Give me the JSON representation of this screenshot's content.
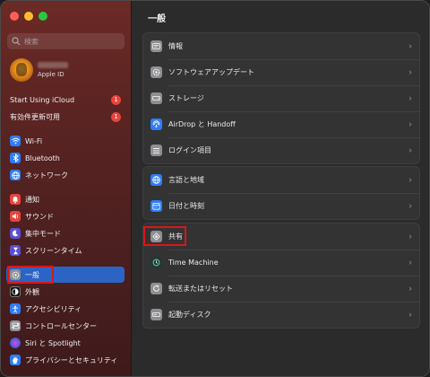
{
  "search": {
    "placeholder": "検索"
  },
  "account": {
    "subtitle": "Apple ID"
  },
  "sidebar": {
    "items": [
      {
        "label": "Start Using iCloud",
        "badge": "1"
      },
      {
        "label": "有効件更新可用",
        "badge": "1"
      },
      {
        "label": "Wi‑Fi",
        "icon": "wifi-icon"
      },
      {
        "label": "Bluetooth",
        "icon": "bluetooth-icon"
      },
      {
        "label": "ネットワーク",
        "icon": "globe-icon"
      },
      {
        "label": "通知",
        "icon": "bell-icon"
      },
      {
        "label": "サウンド",
        "icon": "speaker-icon"
      },
      {
        "label": "集中モード",
        "icon": "moon-icon"
      },
      {
        "label": "スクリーンタイム",
        "icon": "hourglass-icon"
      },
      {
        "label": "一般",
        "icon": "gear-icon",
        "selected": true
      },
      {
        "label": "外観",
        "icon": "appearance-icon"
      },
      {
        "label": "アクセシビリティ",
        "icon": "accessibility-icon"
      },
      {
        "label": "コントロールセンター",
        "icon": "control-center-icon"
      },
      {
        "label": "Siri と Spotlight",
        "icon": "siri-icon"
      },
      {
        "label": "プライバシーとセキュリティ",
        "icon": "hand-icon"
      }
    ]
  },
  "main": {
    "title": "一般",
    "group1": [
      {
        "label": "情報",
        "icon": "info-icon"
      },
      {
        "label": "ソフトウェアアップデート",
        "icon": "gear-update-icon"
      },
      {
        "label": "ストレージ",
        "icon": "storage-icon"
      },
      {
        "label": "AirDrop と Handoff",
        "icon": "airdrop-icon"
      },
      {
        "label": "ログイン項目",
        "icon": "list-icon"
      }
    ],
    "group2": [
      {
        "label": "言語と地域",
        "icon": "language-icon"
      },
      {
        "label": "日付と時刻",
        "icon": "calendar-icon"
      }
    ],
    "group3": [
      {
        "label": "共有",
        "icon": "sharing-icon"
      },
      {
        "label": "Time Machine",
        "icon": "time-machine-icon"
      },
      {
        "label": "転送またはリセット",
        "icon": "reset-icon"
      },
      {
        "label": "起動ディスク",
        "icon": "disk-icon"
      }
    ]
  },
  "colors": {
    "accent": "#2b64c4",
    "badge": "#e8433c",
    "highlight": "#d8161c"
  }
}
